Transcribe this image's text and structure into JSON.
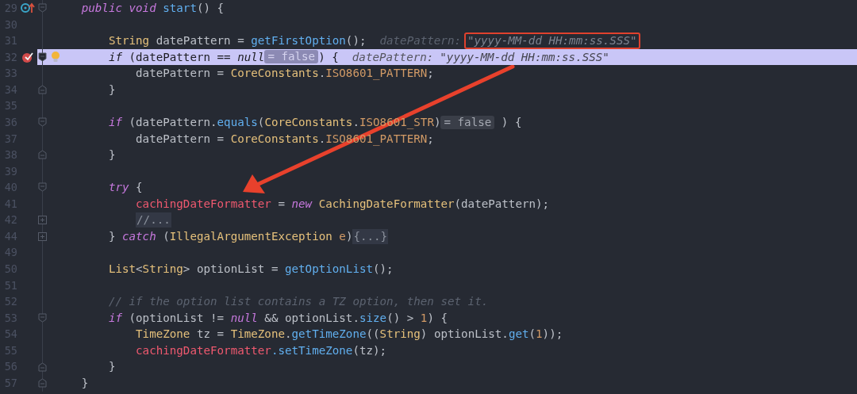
{
  "editor": {
    "lines": [
      {
        "number": "29",
        "current": false,
        "bulb": false,
        "gutter": {
          "kind": "override"
        },
        "fold": {
          "kind": "start"
        },
        "segments": [
          {
            "kind": "code",
            "tokens": [
              {
                "kind": "kw",
                "text": "    public void"
              },
              {
                "kind": "call",
                "text": " start"
              },
              {
                "kind": "plain",
                "text": "() {"
              }
            ]
          }
        ]
      },
      {
        "number": "30",
        "current": false,
        "bulb": false
      },
      {
        "number": "31",
        "current": false,
        "bulb": false,
        "segments": [
          {
            "kind": "code",
            "tokens": [
              {
                "kind": "type",
                "text": "        String"
              },
              {
                "kind": "plain",
                "text": " datePattern = "
              },
              {
                "kind": "call",
                "text": "getFirstOption"
              },
              {
                "kind": "plain",
                "text": "();"
              }
            ]
          },
          {
            "kind": "hint",
            "label": "datePattern:",
            "value": "\"yyyy-MM-dd HH:mm:ss.SSS\"",
            "outlined": true
          }
        ]
      },
      {
        "number": "32",
        "current": true,
        "bulb": true,
        "gutter": {
          "kind": "breakpoint"
        },
        "fold": {
          "kind": "start"
        },
        "segments": [
          {
            "kind": "code",
            "tokens": [
              {
                "kind": "kw",
                "text": "        if"
              },
              {
                "kind": "plain",
                "text": " (datePattern == "
              },
              {
                "kind": "kw",
                "text": "null"
              }
            ]
          },
          {
            "kind": "badge",
            "text": "= false"
          },
          {
            "kind": "code",
            "tokens": [
              {
                "kind": "plain",
                "text": ") {"
              }
            ]
          },
          {
            "kind": "hint",
            "label": "datePattern:",
            "value": "\"yyyy-MM-dd HH:mm:ss.SSS\"",
            "outlined": false
          }
        ]
      },
      {
        "number": "33",
        "current": false,
        "bulb": false,
        "segments": [
          {
            "kind": "code",
            "tokens": [
              {
                "kind": "plain",
                "text": "            datePattern = "
              },
              {
                "kind": "type",
                "text": "CoreConstants"
              },
              {
                "kind": "plain",
                "text": "."
              },
              {
                "kind": "const",
                "text": "ISO8601_PATTERN"
              },
              {
                "kind": "plain",
                "text": ";"
              }
            ]
          }
        ]
      },
      {
        "number": "34",
        "current": false,
        "bulb": false,
        "fold": {
          "kind": "end"
        },
        "segments": [
          {
            "kind": "code",
            "tokens": [
              {
                "kind": "plain",
                "text": "        }"
              }
            ]
          }
        ]
      },
      {
        "number": "35",
        "current": false,
        "bulb": false
      },
      {
        "number": "36",
        "current": false,
        "bulb": false,
        "fold": {
          "kind": "start"
        },
        "segments": [
          {
            "kind": "code",
            "tokens": [
              {
                "kind": "kw",
                "text": "        if"
              },
              {
                "kind": "plain",
                "text": " (datePattern."
              },
              {
                "kind": "call",
                "text": "equals"
              },
              {
                "kind": "plain",
                "text": "("
              },
              {
                "kind": "type",
                "text": "CoreConstants"
              },
              {
                "kind": "plain",
                "text": "."
              },
              {
                "kind": "const",
                "text": "ISO8601_STR"
              },
              {
                "kind": "plain",
                "text": ")"
              }
            ]
          },
          {
            "kind": "badge",
            "text": "= false"
          },
          {
            "kind": "code",
            "tokens": [
              {
                "kind": "plain",
                "text": " ) {"
              }
            ]
          }
        ]
      },
      {
        "number": "37",
        "current": false,
        "bulb": false,
        "segments": [
          {
            "kind": "code",
            "tokens": [
              {
                "kind": "plain",
                "text": "            datePattern = "
              },
              {
                "kind": "type",
                "text": "CoreConstants"
              },
              {
                "kind": "plain",
                "text": "."
              },
              {
                "kind": "const",
                "text": "ISO8601_PATTERN"
              },
              {
                "kind": "plain",
                "text": ";"
              }
            ]
          }
        ]
      },
      {
        "number": "38",
        "current": false,
        "bulb": false,
        "fold": {
          "kind": "end"
        },
        "segments": [
          {
            "kind": "code",
            "tokens": [
              {
                "kind": "plain",
                "text": "        }"
              }
            ]
          }
        ]
      },
      {
        "number": "39",
        "current": false,
        "bulb": false
      },
      {
        "number": "40",
        "current": false,
        "bulb": false,
        "fold": {
          "kind": "start"
        },
        "segments": [
          {
            "kind": "code",
            "tokens": [
              {
                "kind": "kw",
                "text": "        try"
              },
              {
                "kind": "plain",
                "text": " {"
              }
            ]
          }
        ]
      },
      {
        "number": "41",
        "current": false,
        "bulb": false,
        "segments": [
          {
            "kind": "code",
            "tokens": [
              {
                "kind": "field",
                "text": "            cachingDateFormatter"
              },
              {
                "kind": "plain",
                "text": " = "
              },
              {
                "kind": "kw",
                "text": "new"
              },
              {
                "kind": "type",
                "text": " CachingDateFormatter"
              },
              {
                "kind": "plain",
                "text": "(datePattern);"
              }
            ]
          }
        ]
      },
      {
        "number": "42",
        "current": false,
        "bulb": false,
        "fold": {
          "kind": "collapsed"
        },
        "segments": [
          {
            "kind": "folded",
            "text": "            //..."
          }
        ]
      },
      {
        "number": "44",
        "current": false,
        "bulb": false,
        "fold": {
          "kind": "collapsed"
        },
        "segments": [
          {
            "kind": "code",
            "tokens": [
              {
                "kind": "plain",
                "text": "        } "
              },
              {
                "kind": "kw",
                "text": "catch"
              },
              {
                "kind": "plain",
                "text": " ("
              },
              {
                "kind": "type",
                "text": "IllegalArgumentException"
              },
              {
                "kind": "param",
                "text": " e"
              },
              {
                "kind": "plain",
                "text": ")"
              }
            ]
          },
          {
            "kind": "folded",
            "text": "{...}"
          }
        ]
      },
      {
        "number": "49",
        "current": false,
        "bulb": false
      },
      {
        "number": "50",
        "current": false,
        "bulb": false,
        "segments": [
          {
            "kind": "code",
            "tokens": [
              {
                "kind": "type",
                "text": "        List"
              },
              {
                "kind": "plain",
                "text": "<"
              },
              {
                "kind": "type",
                "text": "String"
              },
              {
                "kind": "plain",
                "text": "> optionList = "
              },
              {
                "kind": "call",
                "text": "getOptionList"
              },
              {
                "kind": "plain",
                "text": "();"
              }
            ]
          }
        ]
      },
      {
        "number": "51",
        "current": false,
        "bulb": false
      },
      {
        "number": "52",
        "current": false,
        "bulb": false,
        "segments": [
          {
            "kind": "code",
            "tokens": [
              {
                "kind": "comment",
                "text": "        // if the option list contains a TZ option, then set it."
              }
            ]
          }
        ]
      },
      {
        "number": "53",
        "current": false,
        "bulb": false,
        "fold": {
          "kind": "start"
        },
        "segments": [
          {
            "kind": "code",
            "tokens": [
              {
                "kind": "kw",
                "text": "        if"
              },
              {
                "kind": "plain",
                "text": " (optionList != "
              },
              {
                "kind": "kw",
                "text": "null"
              },
              {
                "kind": "plain",
                "text": " && optionList."
              },
              {
                "kind": "call",
                "text": "size"
              },
              {
                "kind": "plain",
                "text": "() > "
              },
              {
                "kind": "num",
                "text": "1"
              },
              {
                "kind": "plain",
                "text": ") {"
              }
            ]
          }
        ]
      },
      {
        "number": "54",
        "current": false,
        "bulb": false,
        "segments": [
          {
            "kind": "code",
            "tokens": [
              {
                "kind": "type",
                "text": "            TimeZone"
              },
              {
                "kind": "plain",
                "text": " tz = "
              },
              {
                "kind": "type",
                "text": "TimeZone"
              },
              {
                "kind": "plain",
                "text": "."
              },
              {
                "kind": "call",
                "text": "getTimeZone"
              },
              {
                "kind": "plain",
                "text": "(("
              },
              {
                "kind": "type",
                "text": "String"
              },
              {
                "kind": "plain",
                "text": ") optionList."
              },
              {
                "kind": "call",
                "text": "get"
              },
              {
                "kind": "plain",
                "text": "("
              },
              {
                "kind": "num",
                "text": "1"
              },
              {
                "kind": "plain",
                "text": "));"
              }
            ]
          }
        ]
      },
      {
        "number": "55",
        "current": false,
        "bulb": false,
        "segments": [
          {
            "kind": "code",
            "tokens": [
              {
                "kind": "field",
                "text": "            cachingDateFormatter"
              },
              {
                "kind": "call",
                "text": ".setTimeZone"
              },
              {
                "kind": "plain",
                "text": "(tz);"
              }
            ]
          }
        ]
      },
      {
        "number": "56",
        "current": false,
        "bulb": false,
        "fold": {
          "kind": "end"
        },
        "segments": [
          {
            "kind": "code",
            "tokens": [
              {
                "kind": "plain",
                "text": "        }"
              }
            ]
          }
        ]
      },
      {
        "number": "57",
        "current": false,
        "bulb": false,
        "fold": {
          "kind": "end"
        },
        "segments": [
          {
            "kind": "code",
            "tokens": [
              {
                "kind": "plain",
                "text": "    }"
              }
            ]
          }
        ]
      }
    ]
  }
}
